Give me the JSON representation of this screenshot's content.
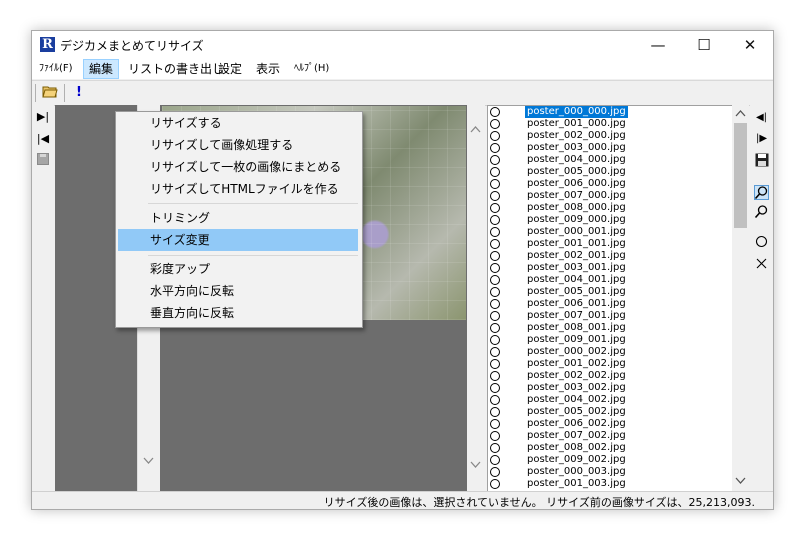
{
  "window": {
    "title": "デジカメまとめてリサイズ",
    "app_icon_letter": "R",
    "controls": {
      "minimize": "—",
      "maximize": "☐",
      "close": "✕"
    }
  },
  "menubar": {
    "file": "ﾌｧｲﾙ(F)",
    "edit": "編集",
    "list_export": "リストの書き出し",
    "settings": "設定",
    "view": "表示",
    "help": "ﾍﾙﾌﾟ(H)"
  },
  "edit_menu": {
    "items": [
      "リサイズする",
      "リサイズして画像処理する",
      "リサイズして一枚の画像にまとめる",
      "リサイズしてHTMLファイルを作る",
      "トリミング",
      "サイズ変更",
      "彩度アップ",
      "水平方向に反転",
      "垂直方向に反転"
    ],
    "highlighted_index": 5
  },
  "file_list": [
    "poster_000_000.jpg",
    "poster_001_000.jpg",
    "poster_002_000.jpg",
    "poster_003_000.jpg",
    "poster_004_000.jpg",
    "poster_005_000.jpg",
    "poster_006_000.jpg",
    "poster_007_000.jpg",
    "poster_008_000.jpg",
    "poster_009_000.jpg",
    "poster_000_001.jpg",
    "poster_001_001.jpg",
    "poster_002_001.jpg",
    "poster_003_001.jpg",
    "poster_004_001.jpg",
    "poster_005_001.jpg",
    "poster_006_001.jpg",
    "poster_007_001.jpg",
    "poster_008_001.jpg",
    "poster_009_001.jpg",
    "poster_000_002.jpg",
    "poster_001_002.jpg",
    "poster_002_002.jpg",
    "poster_003_002.jpg",
    "poster_004_002.jpg",
    "poster_005_002.jpg",
    "poster_006_002.jpg",
    "poster_007_002.jpg",
    "poster_008_002.jpg",
    "poster_009_002.jpg",
    "poster_000_003.jpg",
    "poster_001_003.jpg"
  ],
  "selected_file_index": 0,
  "status": {
    "text": "リサイズ後の画像は、選択されていません。 リサイズ前の画像サイズは、25,213,093."
  }
}
